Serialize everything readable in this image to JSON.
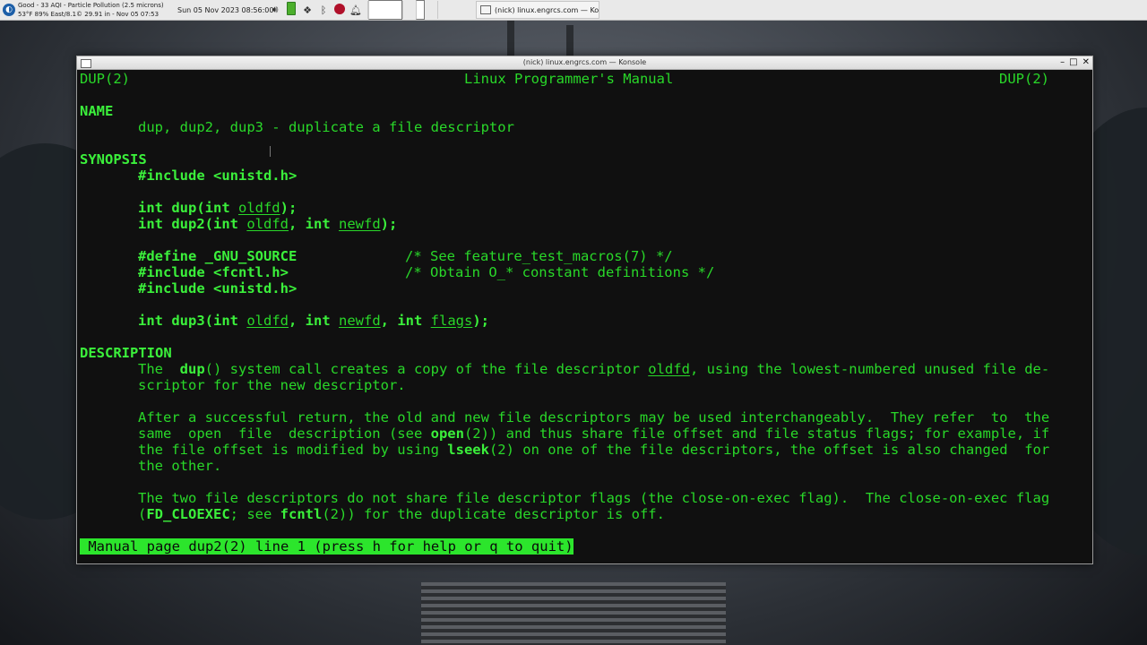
{
  "panel": {
    "launcher_icon": "app-launcher-icon",
    "weather_line1": "Good - 33 AQI - Particle Pollution (2.5 microns)",
    "weather_line2": "53°F 89% East/8.1© 29.91 in - Nov 05 07:53",
    "clock": "Sun 05 Nov 2023 08:56:00",
    "task_title": "(nick) linux.engrcs.com — Ko..."
  },
  "window": {
    "title": "(nick) linux.engrcs.com — Konsole",
    "min": "–",
    "max": "□",
    "close": "✕"
  },
  "man": {
    "header_left": "DUP(2)",
    "header_center": "Linux Programmer's Manual",
    "header_right": "DUP(2)",
    "sec_name": "NAME",
    "name_text": "dup, dup2, dup3 - duplicate a file descriptor",
    "sec_synopsis": "SYNOPSIS",
    "syn1": "#include <unistd.h>",
    "syn2a": "int dup(int ",
    "syn2b": "oldfd",
    "syn2c": ");",
    "syn3a": "int dup2(int ",
    "syn3b": "oldfd",
    "syn3c": ", int ",
    "syn3d": "newfd",
    "syn3e": ");",
    "syn4a": "#define _GNU_SOURCE",
    "syn4b": "/* See feature_test_macros(7) */",
    "syn5a": "#include <fcntl.h>",
    "syn5b": "/* Obtain O_* constant definitions */",
    "syn6": "#include <unistd.h>",
    "syn7a": "int dup3(int ",
    "syn7b": "oldfd",
    "syn7c": ", int ",
    "syn7d": "newfd",
    "syn7e": ", int ",
    "syn7f": "flags",
    "syn7g": ");",
    "sec_description": "DESCRIPTION",
    "d1a": "The  ",
    "d1b": "dup",
    "d1c": "() system call creates a copy of the file descriptor ",
    "d1d": "oldfd",
    "d1e": ", using the lowest-numbered unused file de-",
    "d2": "scriptor for the new descriptor.",
    "d3": "After a successful return, the old and new file descriptors may be used interchangeably.  They refer  to  the",
    "d4a": "same  open  file  description (see ",
    "d4b": "open",
    "d4c": "(2)) and thus share file offset and file status flags; for example, if",
    "d5a": "the file offset is modified by using ",
    "d5b": "lseek",
    "d5c": "(2) on one of the file descriptors, the offset is also changed  for",
    "d6": "the other.",
    "d7": "The two file descriptors do not share file descriptor flags (the close-on-exec flag).  The close-on-exec flag",
    "d8a": "(",
    "d8b": "FD_CLOEXEC",
    "d8c": "; see ",
    "d8d": "fcntl",
    "d8e": "(2)) for the duplicate descriptor is off.",
    "status": " Manual page dup2(2) line 1 (press h for help or q to quit)"
  }
}
